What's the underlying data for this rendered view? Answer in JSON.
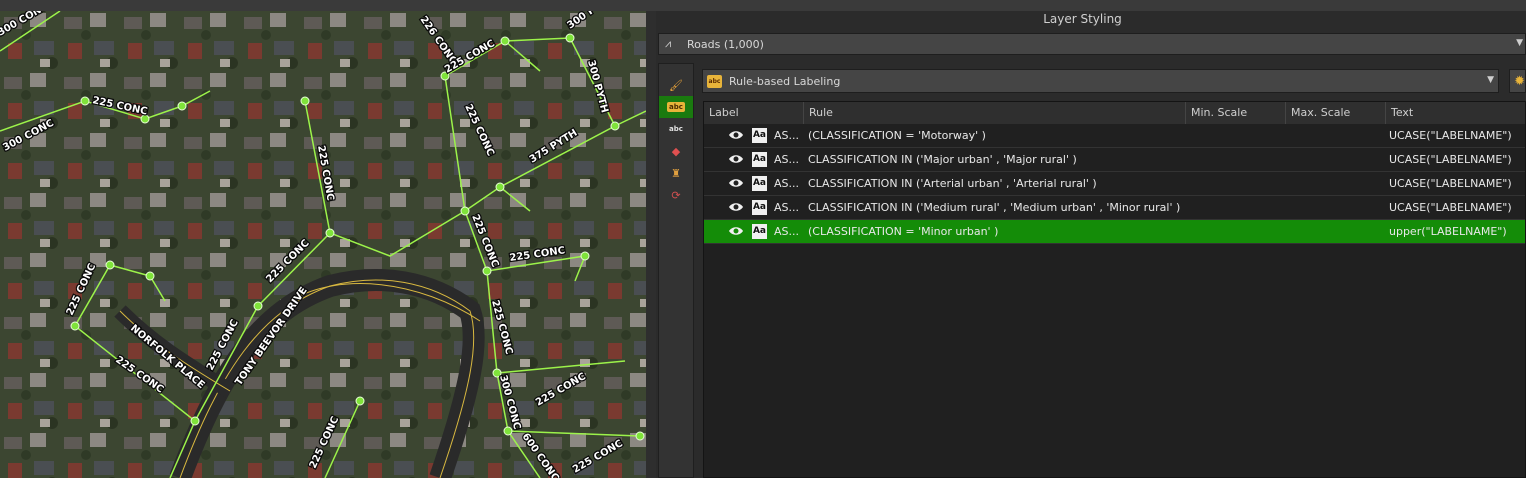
{
  "panel": {
    "title": "Layer Styling",
    "layer_combo": {
      "value": "Roads  (1,000)",
      "icon": "line-layer-icon"
    },
    "mode_combo": {
      "value": "Rule-based Labeling",
      "badge": "abc"
    }
  },
  "sidebar_icons": [
    "paint-brush-icon",
    "labels-icon",
    "abc-diagram-icon",
    "3d-view-icon",
    "fields-icon",
    "rendering-icon"
  ],
  "table": {
    "headers": [
      "Label",
      "Rule",
      "Min. Scale",
      "Max. Scale",
      "Text"
    ],
    "rows": [
      {
        "label": "AS...",
        "rule": "(CLASSIFICATION  = 'Motorway' )",
        "min_scale": "",
        "max_scale": "",
        "text": "UCASE(\"LABELNAME\")",
        "selected": false
      },
      {
        "label": "AS...",
        "rule": "CLASSIFICATION  IN ('Major urban' , 'Major rural'  )",
        "min_scale": "",
        "max_scale": "",
        "text": "UCASE(\"LABELNAME\")",
        "selected": false
      },
      {
        "label": "AS...",
        "rule": "CLASSIFICATION  IN ('Arterial urban' , 'Arterial rural'  )",
        "min_scale": "",
        "max_scale": "",
        "text": "UCASE(\"LABELNAME\")",
        "selected": false
      },
      {
        "label": "AS...",
        "rule": "CLASSIFICATION  IN ('Medium rural' , 'Medium urban' , 'Minor rural'  )",
        "min_scale": "",
        "max_scale": "",
        "text": "UCASE(\"LABELNAME\")",
        "selected": false
      },
      {
        "label": "AS...",
        "rule": "(CLASSIFICATION  = 'Minor urban' )",
        "min_scale": "",
        "max_scale": "",
        "text": "upper(\"LABELNAME\")",
        "selected": true
      }
    ]
  },
  "map": {
    "labels": [
      "300 CONC",
      "225 CONC",
      "300 CONC",
      "226 CONC",
      "225 CONC",
      "300 PYTH",
      "300 PYTH",
      "225 CONC",
      "225 CONC",
      "375 PYTH",
      "225 CONC",
      "225 CONC",
      "225 CONC",
      "225 CONC",
      "225 CONC",
      "225 CONC",
      "NORFOLK PLACE",
      "TONY BEEVOR DRIVE",
      "225 CONC",
      "300 CONC",
      "225 CONC",
      "225 CONC",
      "600 CONC",
      "225 CONC"
    ],
    "colors": {
      "pipe": "#9cf34a",
      "label": "#ffffff",
      "road": "#e0c040"
    }
  },
  "colors": {
    "selected_row": "#148c08",
    "panel_bg": "#2b2b2b"
  }
}
